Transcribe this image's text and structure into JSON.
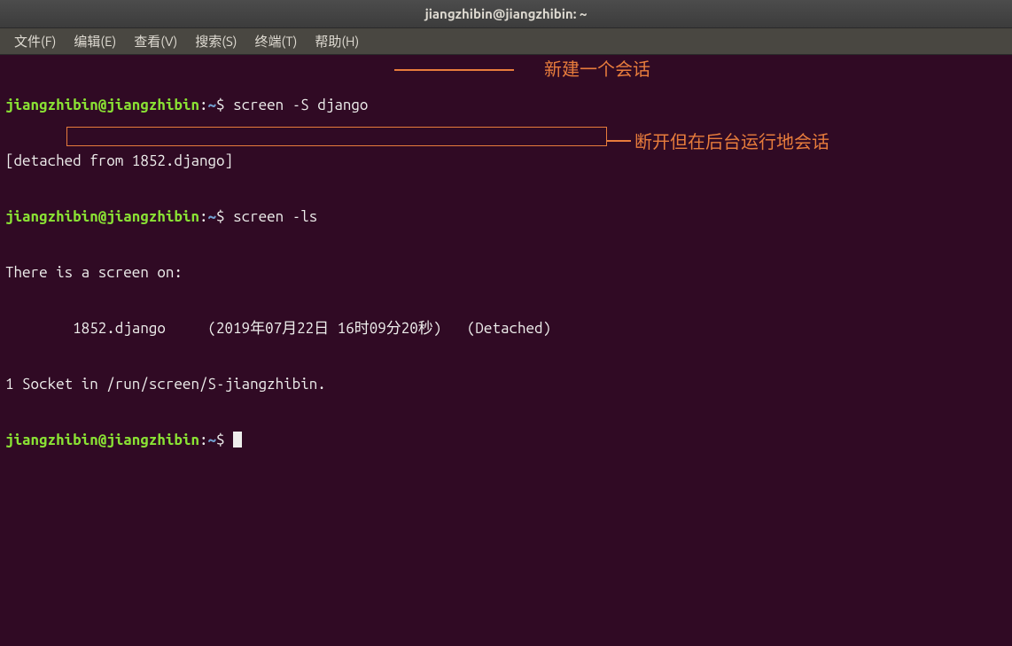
{
  "titlebar": {
    "title": "jiangzhibin@jiangzhibin: ~"
  },
  "menubar": {
    "file": "文件(F)",
    "edit": "编辑(E)",
    "view": "查看(V)",
    "search": "搜索(S)",
    "terminal": "终端(T)",
    "help": "帮助(H)"
  },
  "prompt": {
    "user_host": "jiangzhibin@jiangzhibin",
    "colon": ":",
    "path": "~",
    "dollar": "$"
  },
  "terminal": {
    "line1_cmd": " screen -S django",
    "line2": "[detached from 1852.django]",
    "line3_cmd": " screen -ls",
    "line4": "There is a screen on:",
    "line5": "        1852.django     (2019年07月22日 16时09分20秒)   (Detached)",
    "line6": "1 Socket in /run/screen/S-jiangzhibin.",
    "line7_cmd": " "
  },
  "annotations": {
    "a1": "新建一个会话",
    "a2": "断开但在后台运行地会话"
  }
}
